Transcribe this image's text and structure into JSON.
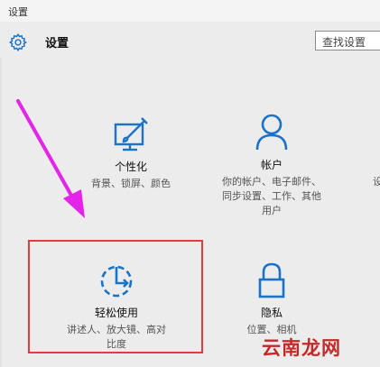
{
  "window": {
    "title": "设置"
  },
  "header": {
    "title": "设置",
    "search_placeholder": "查找设置"
  },
  "tiles": [
    {
      "label": "个性化",
      "desc": [
        "背景、锁屏、颜色"
      ],
      "icon": "personalization-icon"
    },
    {
      "label": "帐户",
      "desc": [
        "你的帐户、电子邮件、",
        "同步设置、工作、其他",
        "用户"
      ],
      "icon": "account-icon"
    },
    {
      "label": "轻松使用",
      "desc": [
        "讲述人、放大镜、高对",
        "比度"
      ],
      "icon": "ease-of-access-icon"
    },
    {
      "label": "隐私",
      "desc": [
        "位置、相机"
      ],
      "icon": "privacy-icon"
    }
  ],
  "edge_text": "设",
  "watermark": "云南龙网",
  "colors": {
    "accent": "#1a73c9",
    "arrow": "#e424e8",
    "highlight": "#e53b3b"
  }
}
